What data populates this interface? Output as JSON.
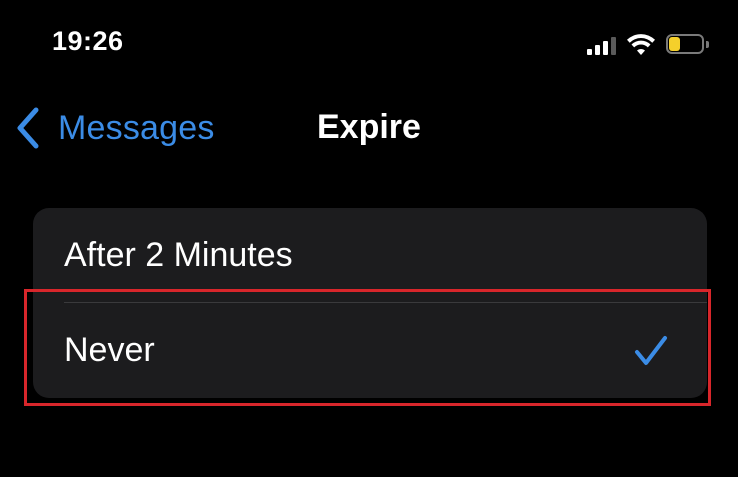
{
  "status_bar": {
    "time": "19:26",
    "signal_icon": "cellular-signal-icon",
    "wifi_icon": "wifi-icon",
    "battery_icon": "battery-icon",
    "battery_level": 0.35,
    "battery_color": "#f5d02b"
  },
  "nav": {
    "back_label": "Messages",
    "back_icon": "chevron-left-icon",
    "title": "Expire",
    "accent_color": "#3b8ce6"
  },
  "options": [
    {
      "label": "After 2 Minutes",
      "selected": false
    },
    {
      "label": "Never",
      "selected": true,
      "icon": "checkmark-icon"
    }
  ],
  "highlight": {
    "color": "#d8262b",
    "target": "Never"
  }
}
